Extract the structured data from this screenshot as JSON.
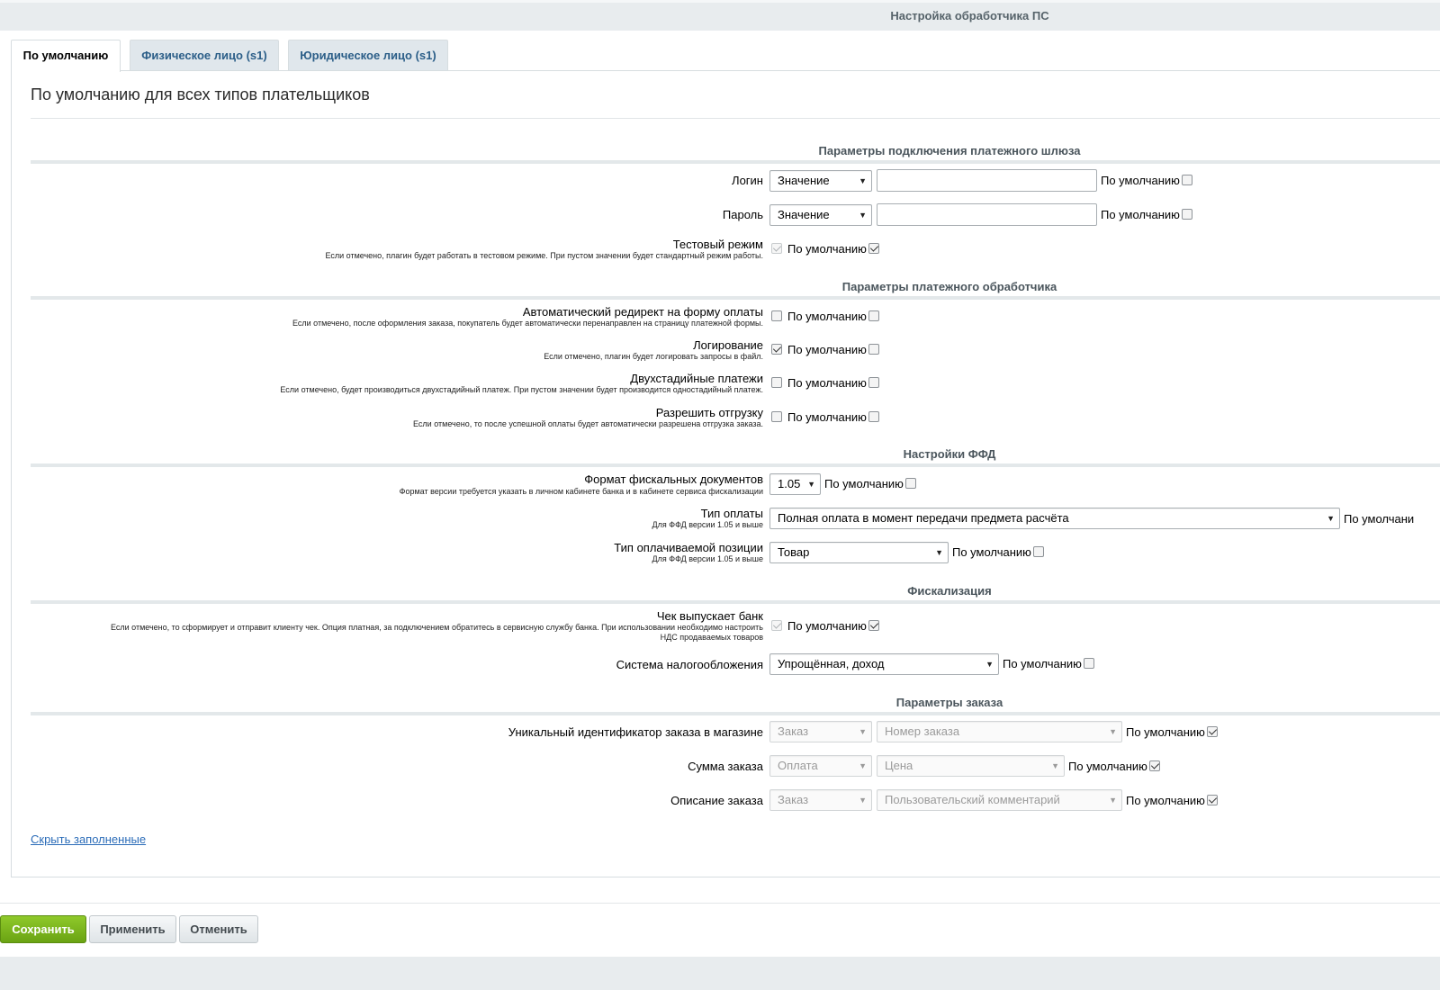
{
  "window": {
    "title": "Настройка обработчика ПС"
  },
  "tabs": [
    {
      "label": "По умолчанию",
      "active": true
    },
    {
      "label": "Физическое лицо (s1)",
      "active": false
    },
    {
      "label": "Юридическое лицо (s1)",
      "active": false
    }
  ],
  "page": {
    "heading": "По умолчанию для всех типов плательщиков"
  },
  "default_label": "По умолчанию",
  "default_label_cut": "По умолчани",
  "sections": {
    "gateway": "Параметры подключения платежного шлюза",
    "handler": "Параметры платежного обработчика",
    "ffd": "Настройки ФФД",
    "fiscal": "Фискализация",
    "order": "Параметры заказа"
  },
  "fields": {
    "login": {
      "label": "Логин",
      "type_value": "Значение",
      "value": "",
      "default_checked": false
    },
    "password": {
      "label": "Пароль",
      "type_value": "Значение",
      "value": "",
      "default_checked": false
    },
    "test_mode": {
      "label": "Тестовый режим",
      "hint": "Если отмечено, плагин будет работать в тестовом режиме. При пустом значении будет стандартный режим работы.",
      "checked": true,
      "default_checked": true
    },
    "auto_redirect": {
      "label": "Автоматический редирект на форму оплаты",
      "hint": "Если отмечено, после оформления заказа, покупатель будет автоматически перенаправлен на страницу платежной формы.",
      "checked": false,
      "default_checked": false
    },
    "logging": {
      "label": "Логирование",
      "hint": "Если отмечено, плагин будет логировать запросы в файл.",
      "checked": true,
      "default_checked": false
    },
    "two_stage": {
      "label": "Двухстадийные платежи",
      "hint": "Если отмечено, будет производиться двухстадийный платеж. При пустом значении будет производится одностадийный платеж.",
      "checked": false,
      "default_checked": false
    },
    "allow_shipment": {
      "label": "Разрешить отгрузку",
      "hint": "Если отмечено, то после успешной оплаты будет автоматически разрешена отгрузка заказа.",
      "checked": false,
      "default_checked": false
    },
    "ffd_format": {
      "label": "Формат фискальных документов",
      "hint": "Формат версии требуется указать в личном кабинете банка и в кабинете сервиса фискализации",
      "value": "1.05",
      "default_checked": false
    },
    "payment_type": {
      "label": "Тип оплаты",
      "hint": "Для ФФД версии 1.05 и выше",
      "value": "Полная оплата в момент передачи предмета расчёта"
    },
    "item_type": {
      "label": "Тип оплачиваемой позиции",
      "hint": "Для ФФД версии 1.05 и выше",
      "value": "Товар",
      "default_checked": false
    },
    "bank_receipt": {
      "label": "Чек выпускает банк",
      "hint1": "Если отмечено, то сформирует и отправит клиенту чек. Опция платная, за подключением обратитесь в сервисную службу банка. При использовании необходимо настроить",
      "hint2": "НДС продаваемых товаров",
      "checked": true,
      "default_checked": true
    },
    "tax_system": {
      "label": "Система налогообложения",
      "value": "Упрощённая, доход",
      "default_checked": false
    },
    "order_id": {
      "label": "Уникальный идентификатор заказа в магазине",
      "type_value": "Заказ",
      "value": "Номер заказа",
      "default_checked": true
    },
    "order_sum": {
      "label": "Сумма заказа",
      "type_value": "Оплата",
      "value": "Цена",
      "default_checked": true
    },
    "order_desc": {
      "label": "Описание заказа",
      "type_value": "Заказ",
      "value": "Пользовательский комментарий",
      "default_checked": true
    }
  },
  "links": {
    "hide_filled": "Скрыть заполненные"
  },
  "buttons": {
    "save": "Сохранить",
    "apply": "Применить",
    "cancel": "Отменить"
  },
  "icons": {
    "dropdown": "dropdown-arrow-icon",
    "check": "checkmark-icon"
  },
  "colors": {
    "save_button": "#7ab51d",
    "tab_text": "#2b5e88",
    "link": "#2b6cb8",
    "topbar": "#e8ecee"
  }
}
